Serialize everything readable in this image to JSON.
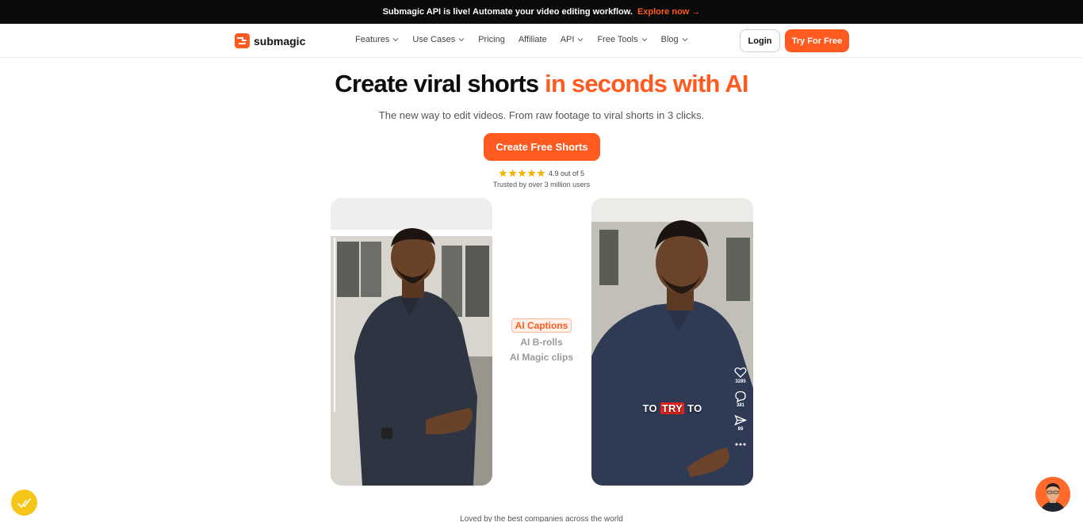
{
  "banner": {
    "text": "Submagic API is live! Automate your video editing workflow.",
    "link": "Explore now →"
  },
  "nav": {
    "logo": "submagic",
    "menu": [
      {
        "label": "Features",
        "dropdown": true
      },
      {
        "label": "Use Cases",
        "dropdown": true
      },
      {
        "label": "Pricing",
        "dropdown": false
      },
      {
        "label": "Affiliate",
        "dropdown": false
      },
      {
        "label": "API",
        "dropdown": true
      },
      {
        "label": "Free Tools",
        "dropdown": true
      },
      {
        "label": "Blog",
        "dropdown": true
      }
    ],
    "login": "Login",
    "try_free": "Try For Free"
  },
  "hero": {
    "title_main": "Create viral shorts ",
    "title_accent": "in seconds with AI",
    "subtitle": "The new way to edit videos. From raw footage to viral shorts in 3 clicks.",
    "cta": "Create Free Shorts",
    "rating_text": "4.9 out of 5",
    "rating_value": 4.9,
    "stars": 5,
    "trusted": "Trusted by over 3 million users"
  },
  "features": [
    "AI Captions",
    "AI B-rolls",
    "AI Magic clips"
  ],
  "preview": {
    "caption_before": "TO ",
    "caption_highlight": "TRY",
    "caption_after": " TO",
    "likes": "3285",
    "comments": "381",
    "shares": "89"
  },
  "footer": {
    "loved": "Loved by the best companies across the world"
  },
  "colors": {
    "accent": "#ff5a1f",
    "banner_bg": "#0a0a0a",
    "caption_highlight": "#e0241b"
  }
}
